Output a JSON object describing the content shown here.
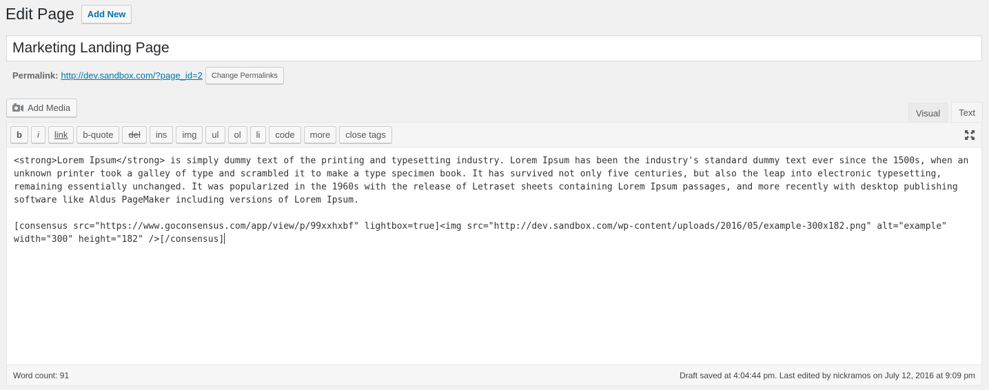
{
  "header": {
    "title": "Edit Page",
    "add_new_label": "Add New"
  },
  "post": {
    "title": "Marketing Landing Page"
  },
  "permalink": {
    "label": "Permalink:",
    "url": "http://dev.sandbox.com/?page_id=2",
    "change_button": "Change Permalinks"
  },
  "media": {
    "add_media_label": "Add Media",
    "icon": "media-camera-icon"
  },
  "editor_tabs": [
    {
      "label": "Visual",
      "active": false
    },
    {
      "label": "Text",
      "active": true
    }
  ],
  "quicktags": [
    {
      "label": "b",
      "style": "bold"
    },
    {
      "label": "i",
      "style": "italic"
    },
    {
      "label": "link",
      "style": "link-style"
    },
    {
      "label": "b-quote",
      "style": ""
    },
    {
      "label": "del",
      "style": "del-style"
    },
    {
      "label": "ins",
      "style": ""
    },
    {
      "label": "img",
      "style": ""
    },
    {
      "label": "ul",
      "style": ""
    },
    {
      "label": "ol",
      "style": ""
    },
    {
      "label": "li",
      "style": ""
    },
    {
      "label": "code",
      "style": ""
    },
    {
      "label": "more",
      "style": ""
    },
    {
      "label": "close tags",
      "style": ""
    }
  ],
  "fullscreen_icon": "fullscreen-icon",
  "content": {
    "paragraph1": "<strong>Lorem Ipsum</strong> is simply dummy text of the printing and typesetting industry. Lorem Ipsum has been the industry's standard dummy text ever since the 1500s, when an unknown printer took a galley of type and scrambled it to make a type specimen book. It has survived not only five centuries, but also the leap into electronic typesetting, remaining essentially unchanged. It was popularized in the 1960s with the release of Letraset sheets containing Lorem Ipsum passages, and more recently with desktop publishing software like Aldus PageMaker including versions of Lorem Ipsum.",
    "paragraph2": "[consensus src=\"https://www.goconsensus.com/app/view/p/99xxhxbf\" lightbox=true]<img src=\"http://dev.sandbox.com/wp-content/uploads/2016/05/example-300x182.png\" alt=\"example\" width=\"300\" height=\"182\" />[/consensus]"
  },
  "status": {
    "word_count": "Word count: 91",
    "draft_saved": "Draft saved at 4:04:44 pm. Last edited by nickramos on July 12, 2016 at 9:09 pm"
  }
}
